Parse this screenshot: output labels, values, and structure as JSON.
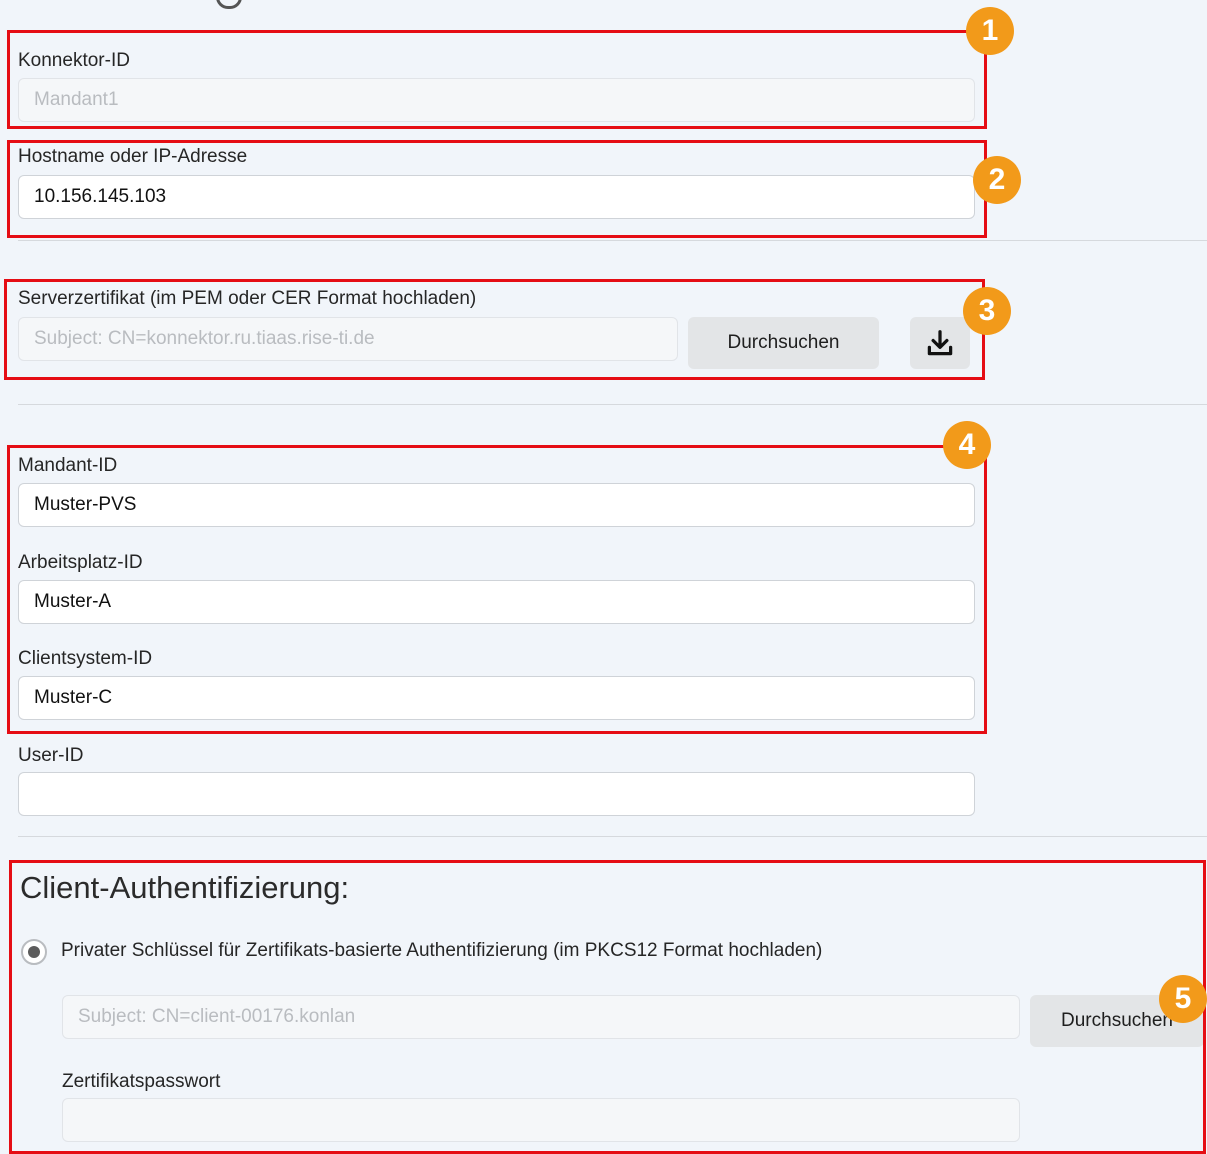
{
  "connector": {
    "id_label": "Konnektor-ID",
    "id_value": "Mandant1",
    "host_label": "Hostname oder IP-Adresse",
    "host_value": "10.156.145.103"
  },
  "server_cert": {
    "label": "Serverzertifikat (im PEM oder CER Format hochladen)",
    "value": "Subject: CN=konnektor.ru.tiaas.rise-ti.de",
    "browse_label": "Durchsuchen",
    "download_icon": "download-icon"
  },
  "context": {
    "mandant_label": "Mandant-ID",
    "mandant_value": "Muster-PVS",
    "workplace_label": "Arbeitsplatz-ID",
    "workplace_value": "Muster-A",
    "clientsystem_label": "Clientsystem-ID",
    "clientsystem_value": "Muster-C",
    "user_label": "User-ID",
    "user_value": ""
  },
  "client_auth": {
    "heading": "Client-Authentifizierung:",
    "radio_label": "Privater Schlüssel für Zertifikats-basierte Authentifizierung (im PKCS12 Format hochladen)",
    "radio_selected": true,
    "cert_value": "Subject: CN=client-00176.konlan",
    "browse_label": "Durchsuchen",
    "password_label": "Zertifikatspasswort",
    "password_value": ""
  },
  "annotations": {
    "badges": [
      "1",
      "2",
      "3",
      "4",
      "5"
    ],
    "box_color": "#e50d14",
    "badge_color": "#f29a1a"
  }
}
